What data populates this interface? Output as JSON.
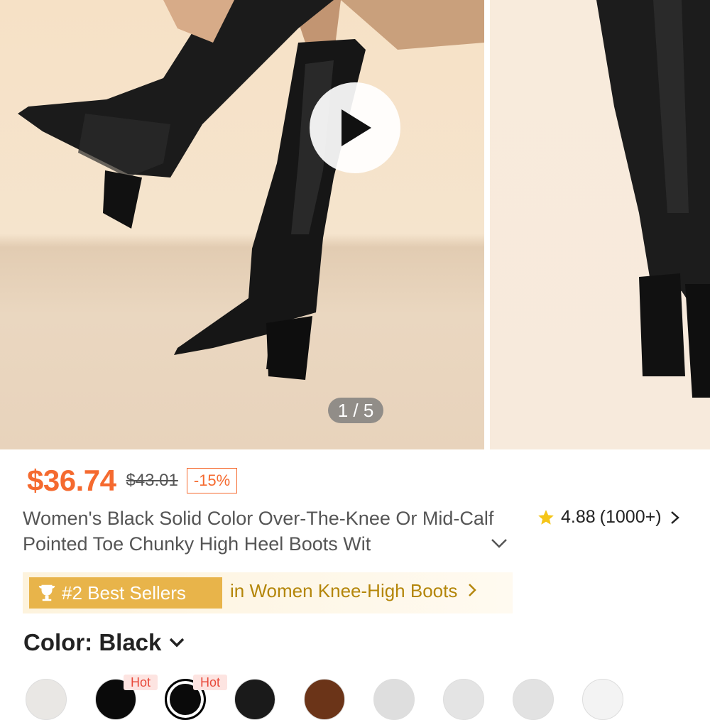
{
  "gallery": {
    "counter": "1 / 5",
    "play_icon": "play-icon"
  },
  "price": {
    "current": "$36.74",
    "original": "$43.01",
    "discount": "-15%",
    "accent_color": "#f56a2f"
  },
  "product": {
    "title": "Women's Black Solid Color Over-The-Knee Or Mid-Calf Pointed Toe Chunky High Heel Boots Wit",
    "expand_icon": "chevron-down-icon"
  },
  "rating": {
    "value": "4.88",
    "count": "(1000+)",
    "star_icon": "star-icon"
  },
  "best_sellers": {
    "badge": "#2 Best Sellers",
    "link": "in Women Knee-High Boots",
    "badge_color": "#e8b44a"
  },
  "color_selector": {
    "label": "Color: Black",
    "hot_label": "Hot",
    "swatches": [
      {
        "color": "#e9e7e4"
      },
      {
        "color": "#0a0a0a"
      },
      {
        "color": "#0a0a0a"
      },
      {
        "color": "#1a1a1a"
      },
      {
        "color": "#6b3418"
      },
      {
        "color": "#dedede"
      },
      {
        "color": "#e4e4e4"
      },
      {
        "color": "#e2e2e2"
      },
      {
        "color": "#f3f3f3"
      }
    ]
  }
}
